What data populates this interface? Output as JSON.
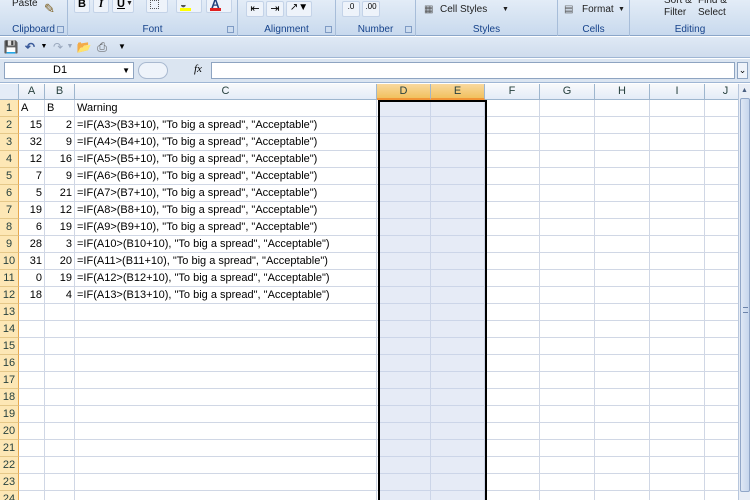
{
  "ribbon": {
    "clipboard": {
      "paste_label": "Paste",
      "group_label": "Clipboard"
    },
    "font": {
      "bold": "B",
      "italic": "I",
      "underline": "U",
      "font_color_letter": "A",
      "group_label": "Font"
    },
    "alignment": {
      "group_label": "Alignment"
    },
    "number": {
      "group_label": "Number"
    },
    "styles": {
      "cell_styles_label": "Cell Styles",
      "group_label": "Styles"
    },
    "cells": {
      "format_label": "Format",
      "group_label": "Cells"
    },
    "editing": {
      "sort_filter_label": "Sort &\nFilter",
      "find_select_label": "Find &\nSelect",
      "group_label": "Editing"
    }
  },
  "formula_bar": {
    "name_box": "D1",
    "fx_symbol": "fx",
    "formula": ""
  },
  "sheet": {
    "columns": [
      "A",
      "B",
      "C",
      "D",
      "E",
      "F",
      "G",
      "H",
      "I",
      "J"
    ],
    "selected_columns": [
      "D",
      "E"
    ],
    "row_numbers": [
      "1",
      "2",
      "3",
      "4",
      "5",
      "6",
      "7",
      "8",
      "9",
      "10",
      "11",
      "12",
      "13",
      "14",
      "15",
      "16",
      "17",
      "18",
      "19",
      "20",
      "21",
      "22",
      "23",
      "24"
    ],
    "rows": [
      {
        "a": "A",
        "b": "B",
        "c": "Warning"
      },
      {
        "a": "15",
        "b": "2",
        "c": "=IF(A3>(B3+10), \"To big a spread\", \"Acceptable\")"
      },
      {
        "a": "32",
        "b": "9",
        "c": "=IF(A4>(B4+10), \"To big a spread\", \"Acceptable\")"
      },
      {
        "a": "12",
        "b": "16",
        "c": "=IF(A5>(B5+10), \"To big a spread\", \"Acceptable\")"
      },
      {
        "a": "7",
        "b": "9",
        "c": "=IF(A6>(B6+10), \"To big a spread\", \"Acceptable\")"
      },
      {
        "a": "5",
        "b": "21",
        "c": "=IF(A7>(B7+10), \"To big a spread\", \"Acceptable\")"
      },
      {
        "a": "19",
        "b": "12",
        "c": "=IF(A8>(B8+10), \"To big a spread\", \"Acceptable\")"
      },
      {
        "a": "6",
        "b": "19",
        "c": "=IF(A9>(B9+10), \"To big a spread\", \"Acceptable\")"
      },
      {
        "a": "28",
        "b": "3",
        "c": "=IF(A10>(B10+10), \"To big a spread\", \"Acceptable\")"
      },
      {
        "a": "31",
        "b": "20",
        "c": "=IF(A11>(B11+10), \"To big a spread\", \"Acceptable\")"
      },
      {
        "a": "0",
        "b": "19",
        "c": "=IF(A12>(B12+10), \"To big a spread\", \"Acceptable\")"
      },
      {
        "a": "18",
        "b": "4",
        "c": "=IF(A13>(B13+10), \"To big a spread\", \"Acceptable\")"
      }
    ]
  },
  "icons": {
    "format_painter": "paintbrush-icon",
    "save": "save-icon",
    "undo": "undo-icon",
    "redo": "redo-icon",
    "open": "folder-icon",
    "print": "print-icon"
  },
  "colors": {
    "selected_header": "#f1c15f",
    "row_header": "#fde7b5",
    "ribbon_text": "#15428b"
  }
}
